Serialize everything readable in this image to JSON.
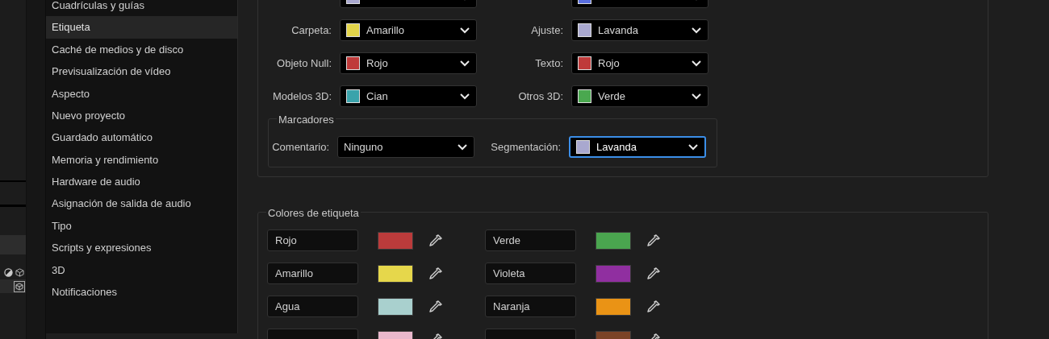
{
  "sidebar": {
    "items": [
      {
        "label": "Cuadrículas y guías",
        "selected": false
      },
      {
        "label": "Etiqueta",
        "selected": true
      },
      {
        "label": "Caché de medios y de disco",
        "selected": false
      },
      {
        "label": "Previsualización de vídeo",
        "selected": false
      },
      {
        "label": "Aspecto",
        "selected": false
      },
      {
        "label": "Nuevo proyecto",
        "selected": false
      },
      {
        "label": "Guardado automático",
        "selected": false
      },
      {
        "label": "Memoria y rendimiento",
        "selected": false
      },
      {
        "label": "Hardware de audio",
        "selected": false
      },
      {
        "label": "Asignación de salida de audio",
        "selected": false
      },
      {
        "label": "Tipo",
        "selected": false
      },
      {
        "label": "Scripts y expresiones",
        "selected": false
      },
      {
        "label": "3D",
        "selected": false
      },
      {
        "label": "Notificaciones",
        "selected": false
      }
    ]
  },
  "defaults": {
    "rows": [
      [
        {
          "color": "#a9a8cf"
        },
        {
          "color": "#5a6fe0"
        }
      ],
      [
        {
          "label": "Carpeta:",
          "value": "Amarillo",
          "color": "#e3d54a"
        },
        {
          "label": "Ajuste:",
          "value": "Lavanda",
          "color": "#a9a8cf"
        }
      ],
      [
        {
          "label": "Objeto Null:",
          "value": "Rojo",
          "color": "#bf3a3a"
        },
        {
          "label": "Texto:",
          "value": "Rojo",
          "color": "#bf3a3a"
        }
      ],
      [
        {
          "label": "Modelos 3D:",
          "value": "Cian",
          "color": "#3aa3ab"
        },
        {
          "label": "Otros 3D:",
          "value": "Verde",
          "color": "#4aa84f"
        }
      ]
    ]
  },
  "markers": {
    "title": "Marcadores",
    "fields": [
      {
        "label": "Comentario:",
        "value": "Ninguno",
        "focused": false
      },
      {
        "label": "Segmentación:",
        "value": "Lavanda",
        "color": "#a9a8cf",
        "focused": true
      }
    ]
  },
  "label_colors": {
    "title": "Colores de etiqueta",
    "items": [
      {
        "name": "Rojo",
        "color": "#bb3b3b"
      },
      {
        "name": "Verde",
        "color": "#4aa54f"
      },
      {
        "name": "Amarillo",
        "color": "#e6d74b"
      },
      {
        "name": "Violeta",
        "color": "#902fa0"
      },
      {
        "name": "Agua",
        "color": "#a9d0ce"
      },
      {
        "name": "Naranja",
        "color": "#ea9315"
      },
      {
        "color": "#e9b8cc"
      },
      {
        "color": "#7b4327"
      }
    ]
  }
}
